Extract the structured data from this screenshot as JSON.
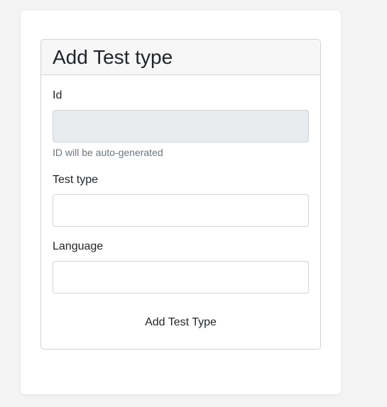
{
  "form": {
    "title": "Add Test type",
    "id_field": {
      "label": "Id",
      "value": "",
      "help_text": "ID will be auto-generated"
    },
    "test_type_field": {
      "label": "Test type",
      "value": ""
    },
    "language_field": {
      "label": "Language",
      "value": ""
    },
    "submit_label": "Add Test Type"
  }
}
